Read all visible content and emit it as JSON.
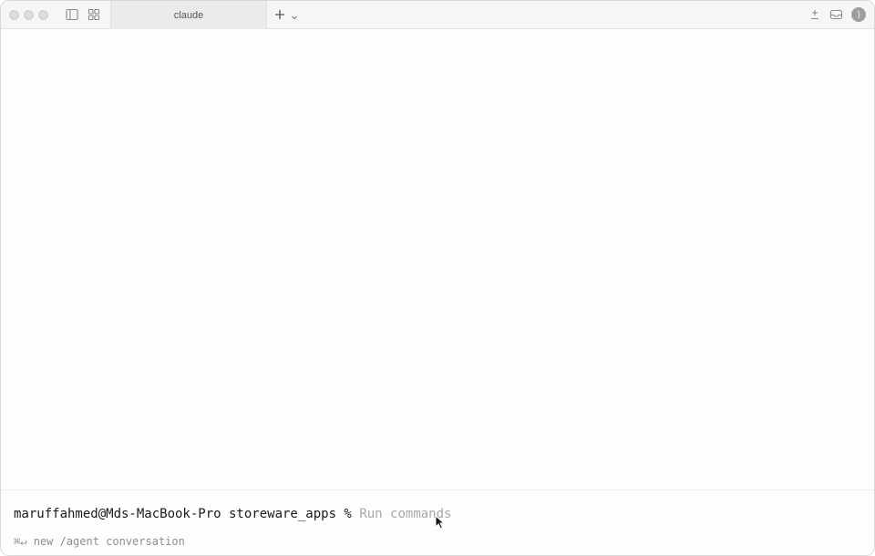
{
  "tab": {
    "title": "claude"
  },
  "prompt": {
    "text": "maruffahmed@Mds-MacBook-Pro storeware_apps %",
    "placeholder": "Run commands"
  },
  "hint": {
    "keys": "⌘↵",
    "text": "new /agent conversation"
  },
  "icons": {
    "sidebar": "sidebar-toggle-icon",
    "grid": "grid-icon",
    "plus": "plus-icon",
    "chevron": "chevron-down-icon",
    "plus_minus": "plus-minus-icon",
    "inbox": "inbox-icon",
    "avatar": "avatar"
  }
}
